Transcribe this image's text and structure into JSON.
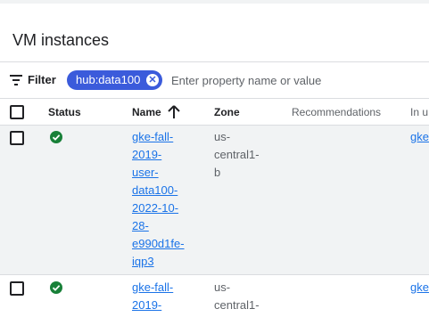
{
  "page": {
    "title": "VM instances"
  },
  "filter": {
    "label": "Filter",
    "chip": "hub:data100",
    "placeholder": "Enter property name or value"
  },
  "columns": {
    "status": "Status",
    "name": "Name",
    "zone": "Zone",
    "recommendations": "Recommendations",
    "in_use": "In u"
  },
  "rows": [
    {
      "name_lines": [
        "gke-fall-",
        "2019-",
        "user-",
        "data100-",
        "2022-10-",
        "28-",
        "e990d1fe-",
        "iqp3"
      ],
      "zone_lines": [
        "us-",
        "central1-",
        "b"
      ],
      "in_use": "gke"
    },
    {
      "name_lines": [
        "gke-fall-",
        "2019-"
      ],
      "zone_lines": [
        "us-",
        "central1-"
      ],
      "in_use": "gke"
    }
  ],
  "colors": {
    "accent": "#3b5bdb",
    "link": "#1a73e8",
    "status_ok": "#188038"
  },
  "icons": {
    "filter": "filter-icon",
    "sort": "arrow-upward-icon",
    "status": "check-circle-icon",
    "chip_close": "close-icon"
  }
}
